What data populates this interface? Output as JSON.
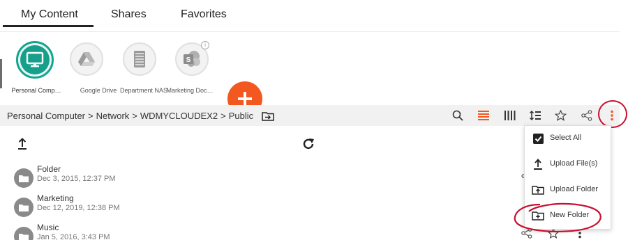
{
  "tabs": [
    {
      "label": "My Content"
    },
    {
      "label": "Shares"
    },
    {
      "label": "Favorites"
    }
  ],
  "sources": [
    {
      "label": "Personal Comp…",
      "icon": "computer-icon"
    },
    {
      "label": "Google Drive",
      "icon": "google-drive-icon"
    },
    {
      "label": "Department NAS",
      "icon": "nas-icon"
    },
    {
      "label": "Marketing Doc…",
      "icon": "sharepoint-icon",
      "badge": "i"
    }
  ],
  "breadcrumb": [
    "Personal Computer",
    "Network",
    "WDMYCLOUDEX2",
    "Public"
  ],
  "breadcrumb_separator": ">",
  "files": [
    {
      "name": "Folder",
      "date": "Dec 3, 2015, 12:37 PM"
    },
    {
      "name": "Marketing",
      "date": "Dec 12, 2019, 12:38 PM"
    },
    {
      "name": "Music",
      "date": "Jan 5, 2016, 3:43 PM"
    }
  ],
  "menu": [
    {
      "label": "Select All",
      "icon": "checkbox-icon"
    },
    {
      "label": "Upload File(s)",
      "icon": "upload-icon"
    },
    {
      "label": "Upload Folder",
      "icon": "upload-folder-icon"
    },
    {
      "label": "New Folder",
      "icon": "new-folder-icon"
    }
  ],
  "colors": {
    "accent": "#f2581f",
    "selected_source": "#16a08c",
    "annotation": "#c8102e"
  }
}
